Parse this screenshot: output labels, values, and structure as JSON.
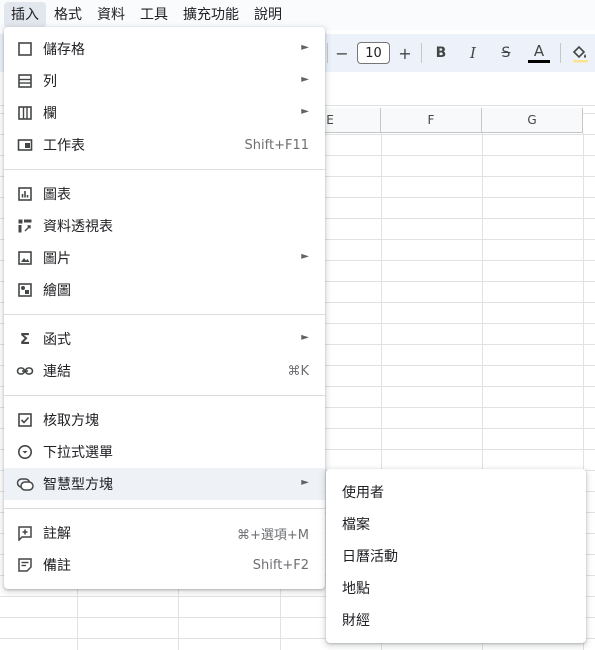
{
  "menubar": {
    "items": [
      "插入",
      "格式",
      "資料",
      "工具",
      "擴充功能",
      "說明"
    ]
  },
  "toolbar": {
    "font_size": "10",
    "minus": "−",
    "plus": "+",
    "bold": "B",
    "italic": "I",
    "strike": "S",
    "text_color": "A"
  },
  "columns": [
    "E",
    "F",
    "G"
  ],
  "menu": {
    "cells": "儲存格",
    "rows": "列",
    "columns": "欄",
    "sheet": "工作表",
    "sheet_shortcut": "Shift+F11",
    "chart": "圖表",
    "pivot": "資料透視表",
    "image": "圖片",
    "drawing": "繪圖",
    "function": "函式",
    "link": "連結",
    "link_shortcut": "⌘K",
    "checkbox": "核取方塊",
    "dropdown": "下拉式選單",
    "smart_chips": "智慧型方塊",
    "comment": "註解",
    "comment_shortcut": "⌘+選項+M",
    "note": "備註",
    "note_shortcut": "Shift+F2"
  },
  "submenu": {
    "items": [
      "使用者",
      "檔案",
      "日曆活動",
      "地點",
      "財經"
    ]
  },
  "colors": {
    "menu_hover": "#eef1f6",
    "toolbar_bg": "#edf2fa"
  }
}
